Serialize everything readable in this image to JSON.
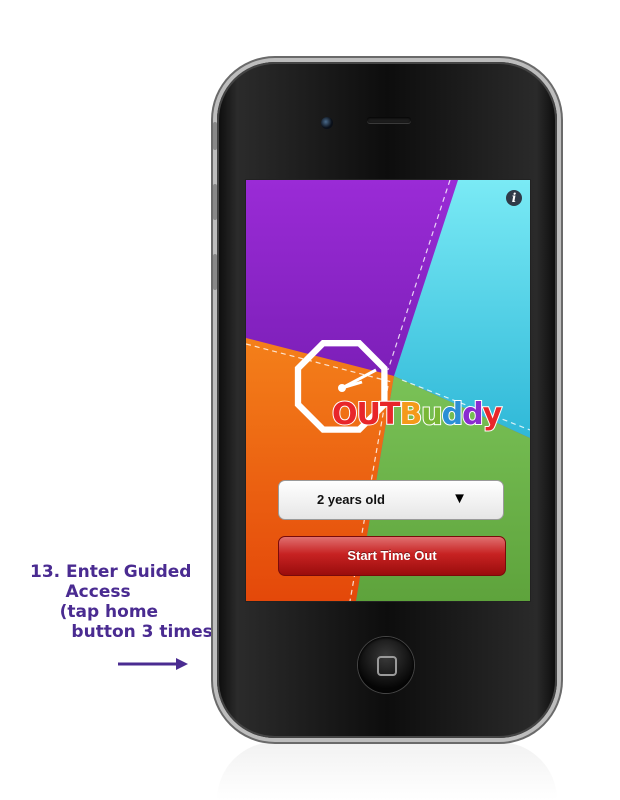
{
  "annotation": {
    "lines": [
      "13. Enter Guided",
      "      Access",
      "     (tap home",
      "       button 3 times)"
    ],
    "color": "#4a2b91"
  },
  "app": {
    "logo_text": [
      "O",
      "U",
      "T",
      "B",
      "u",
      "d",
      "d",
      "y"
    ],
    "logo_colors": [
      "#e8262a",
      "#e8262a",
      "#e8262a",
      "#f49a1a",
      "#79b736",
      "#2b8fd6",
      "#8a2bd0",
      "#e8262a"
    ],
    "age_select": {
      "value": "2 years old",
      "arrow": "▼"
    },
    "start_button": {
      "label": "Start Time Out",
      "color": "#c72222"
    },
    "info_icon": "i",
    "background_colors": {
      "purple": "#8e24cc",
      "cyan": "#55d4e8",
      "orange": "#f0650f",
      "green": "#6bb04a"
    }
  }
}
